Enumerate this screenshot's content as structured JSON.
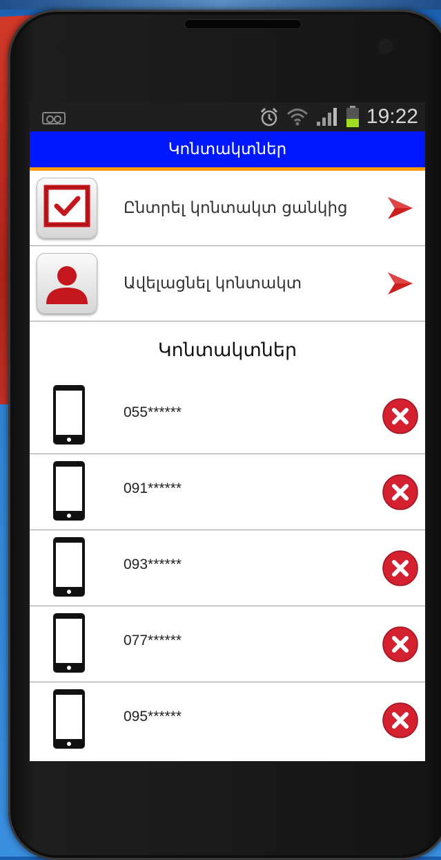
{
  "status_bar": {
    "time": "19:22",
    "icons": [
      "voicemail-icon",
      "alarm-icon",
      "wifi-icon",
      "signal-icon",
      "battery-icon"
    ]
  },
  "app_bar": {
    "title": "Կոնտակտներ"
  },
  "actions": [
    {
      "label": "Ընտրել կոնտակտ ցանկից",
      "icon": "checkbox-icon"
    },
    {
      "label": "Ավելացնել կոնտակտ",
      "icon": "user-icon"
    }
  ],
  "section": {
    "title": "Կոնտակտներ"
  },
  "contacts": [
    {
      "number": "055******"
    },
    {
      "number": "091******"
    },
    {
      "number": "093******"
    },
    {
      "number": "077******"
    },
    {
      "number": "095******"
    }
  ],
  "colors": {
    "app_bar": "#0018ff",
    "accent_line": "#ff9900",
    "delete": "#d4202f",
    "arrow": "#cc1f1f"
  }
}
